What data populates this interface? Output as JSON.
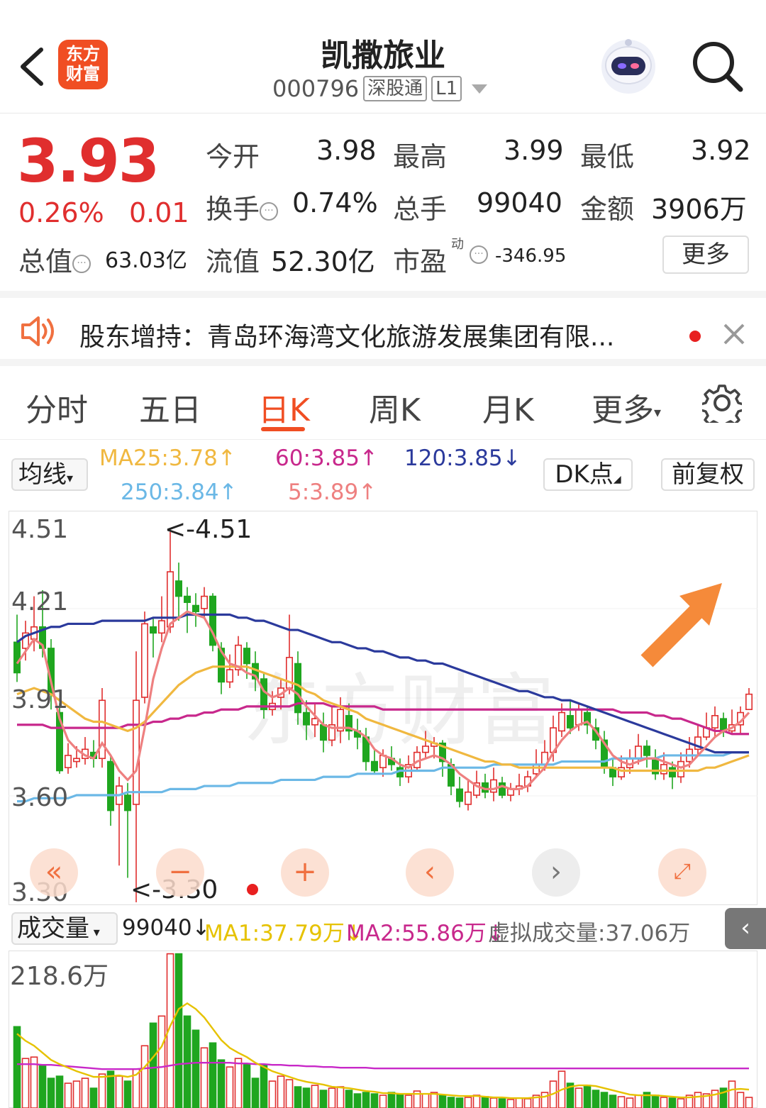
{
  "header": {
    "app_logo_text": "东方财富",
    "stock_name": "凯撒旅业",
    "stock_code": "000796",
    "tag_connect": "深股通",
    "tag_level": "L1"
  },
  "quote": {
    "price": "3.93",
    "change_pct": "0.26%",
    "change_amt": "0.01",
    "open_label": "今开",
    "open": "3.98",
    "high_label": "最高",
    "high": "3.99",
    "low_label": "最低",
    "low": "3.92",
    "turnover_label": "换手",
    "turnover": "0.74%",
    "volume_label": "总手",
    "volume": "99040",
    "amount_label": "金额",
    "amount": "3906万",
    "mktcap_label": "总值",
    "mktcap": "63.03亿",
    "float_label": "流值",
    "float": "52.30亿",
    "pe_label": "市盈",
    "pe_sup": "动",
    "pe": "-346.95",
    "more_label": "更多"
  },
  "notice": {
    "text": "股东增持：青岛环海湾文化旅游发展集团有限..."
  },
  "tabs": [
    "分时",
    "五日",
    "日K",
    "周K",
    "月K",
    "更多"
  ],
  "ma_bar": {
    "selector": "均线",
    "ma25": "MA25:3.78↑",
    "ma60": "60:3.85↑",
    "ma120": "120:3.85↓",
    "ma250": "250:3.84↑",
    "ma5": "5:3.89↑",
    "dk": "DK点",
    "adjust": "前复权"
  },
  "colors": {
    "up": "#e02e2e",
    "down": "#1fa61f",
    "ma5": "#ee8080",
    "ma25": "#f0b840",
    "ma60": "#c8288c",
    "ma120": "#2b3a9c",
    "ma250": "#6bb8e6",
    "accent": "#f04e23"
  },
  "kchart_labels": {
    "y_ticks": [
      "4.51",
      "4.21",
      "3.91",
      "3.60",
      "3.30"
    ],
    "max_note": "<-4.51",
    "min_note": "<-3.30"
  },
  "volume_bar": {
    "selector": "成交量",
    "vol": "99040↓",
    "ma1": "MA1:37.79万↓",
    "ma2": "MA2:55.86万↓",
    "virtual": "虚拟成交量:37.06万",
    "max_label": "218.6万"
  },
  "chart_data": {
    "type": "candlestick",
    "ylim": [
      3.3,
      4.51
    ],
    "candles": [
      [
        4.15,
        4.05,
        4.24,
        4.02
      ],
      [
        4.13,
        4.18,
        4.22,
        4.09
      ],
      [
        4.16,
        4.2,
        4.3,
        4.12
      ],
      [
        4.2,
        4.13,
        4.32,
        4.1
      ],
      [
        4.13,
        3.98,
        4.16,
        3.93
      ],
      [
        3.92,
        3.73,
        3.95,
        3.72
      ],
      [
        3.74,
        3.78,
        3.82,
        3.72
      ],
      [
        3.76,
        3.77,
        3.81,
        3.74
      ],
      [
        3.77,
        3.8,
        3.84,
        3.75
      ],
      [
        3.79,
        3.77,
        3.83,
        3.74
      ],
      [
        3.77,
        3.96,
        4.0,
        3.74
      ],
      [
        3.76,
        3.6,
        3.78,
        3.55
      ],
      [
        3.62,
        3.68,
        3.71,
        3.42
      ],
      [
        3.65,
        3.6,
        3.69,
        3.38
      ],
      [
        3.62,
        3.96,
        4.12,
        3.3
      ],
      [
        3.97,
        4.21,
        4.25,
        3.95
      ],
      [
        4.2,
        4.18,
        4.23,
        4.1
      ],
      [
        4.18,
        4.22,
        4.3,
        4.15
      ],
      [
        4.2,
        4.38,
        4.51,
        4.18
      ],
      [
        4.35,
        4.3,
        4.41,
        4.22
      ],
      [
        4.3,
        4.28,
        4.33,
        4.18
      ],
      [
        4.27,
        4.25,
        4.31,
        4.2
      ],
      [
        4.26,
        4.3,
        4.33,
        4.23
      ],
      [
        4.3,
        4.14,
        4.31,
        4.12
      ],
      [
        4.13,
        4.02,
        4.15,
        3.98
      ],
      [
        4.02,
        4.06,
        4.11,
        4.0
      ],
      [
        4.06,
        4.14,
        4.17,
        4.04
      ],
      [
        4.13,
        4.08,
        4.15,
        4.03
      ],
      [
        4.08,
        4.03,
        4.12,
        3.99
      ],
      [
        4.03,
        3.93,
        4.05,
        3.9
      ],
      [
        3.93,
        3.95,
        3.99,
        3.91
      ],
      [
        3.97,
        4.0,
        4.03,
        3.93
      ],
      [
        4.0,
        4.1,
        4.24,
        3.98
      ],
      [
        4.08,
        3.92,
        4.12,
        3.88
      ],
      [
        3.92,
        3.88,
        3.96,
        3.83
      ],
      [
        3.88,
        3.9,
        3.95,
        3.84
      ],
      [
        3.88,
        3.83,
        3.92,
        3.79
      ],
      [
        3.83,
        3.88,
        3.94,
        3.81
      ],
      [
        3.86,
        3.93,
        3.97,
        3.82
      ],
      [
        3.91,
        3.86,
        3.95,
        3.83
      ],
      [
        3.86,
        3.84,
        3.9,
        3.8
      ],
      [
        3.84,
        3.76,
        3.87,
        3.73
      ],
      [
        3.76,
        3.73,
        3.8,
        3.72
      ],
      [
        3.74,
        3.78,
        3.8,
        3.71
      ],
      [
        3.77,
        3.75,
        3.81,
        3.73
      ],
      [
        3.74,
        3.71,
        3.77,
        3.68
      ],
      [
        3.71,
        3.75,
        3.78,
        3.69
      ],
      [
        3.74,
        3.79,
        3.81,
        3.73
      ],
      [
        3.79,
        3.81,
        3.86,
        3.77
      ],
      [
        3.81,
        3.82,
        3.84,
        3.77
      ],
      [
        3.82,
        3.76,
        3.83,
        3.71
      ],
      [
        3.75,
        3.68,
        3.77,
        3.65
      ],
      [
        3.67,
        3.63,
        3.71,
        3.61
      ],
      [
        3.62,
        3.66,
        3.7,
        3.6
      ],
      [
        3.65,
        3.69,
        3.73,
        3.64
      ],
      [
        3.69,
        3.66,
        3.72,
        3.64
      ],
      [
        3.66,
        3.7,
        3.74,
        3.63
      ],
      [
        3.69,
        3.65,
        3.71,
        3.64
      ],
      [
        3.65,
        3.67,
        3.69,
        3.63
      ],
      [
        3.67,
        3.68,
        3.72,
        3.65
      ],
      [
        3.68,
        3.71,
        3.73,
        3.66
      ],
      [
        3.72,
        3.75,
        3.8,
        3.71
      ],
      [
        3.75,
        3.79,
        3.83,
        3.73
      ],
      [
        3.79,
        3.87,
        3.91,
        3.76
      ],
      [
        3.86,
        3.92,
        3.95,
        3.84
      ],
      [
        3.91,
        3.87,
        3.96,
        3.85
      ],
      [
        3.88,
        3.93,
        3.95,
        3.86
      ],
      [
        3.92,
        3.88,
        3.94,
        3.85
      ],
      [
        3.87,
        3.83,
        3.9,
        3.8
      ],
      [
        3.83,
        3.74,
        3.86,
        3.72
      ],
      [
        3.74,
        3.71,
        3.77,
        3.68
      ],
      [
        3.71,
        3.74,
        3.78,
        3.7
      ],
      [
        3.74,
        3.77,
        3.8,
        3.72
      ],
      [
        3.77,
        3.81,
        3.85,
        3.75
      ],
      [
        3.81,
        3.78,
        3.83,
        3.74
      ],
      [
        3.77,
        3.72,
        3.8,
        3.7
      ],
      [
        3.72,
        3.75,
        3.79,
        3.7
      ],
      [
        3.74,
        3.71,
        3.76,
        3.67
      ],
      [
        3.71,
        3.76,
        3.79,
        3.69
      ],
      [
        3.76,
        3.8,
        3.84,
        3.74
      ],
      [
        3.8,
        3.84,
        3.88,
        3.78
      ],
      [
        3.84,
        3.87,
        3.92,
        3.83
      ],
      [
        3.87,
        3.91,
        3.94,
        3.84
      ],
      [
        3.9,
        3.86,
        3.92,
        3.84
      ],
      [
        3.86,
        3.88,
        3.93,
        3.85
      ],
      [
        3.88,
        3.92,
        3.94,
        3.85
      ],
      [
        3.93,
        3.98,
        4.0,
        3.93
      ]
    ],
    "ma5": [
      4.08,
      4.12,
      4.16,
      4.14,
      4.02,
      3.9,
      3.83,
      3.8,
      3.78,
      3.77,
      3.82,
      3.78,
      3.73,
      3.7,
      3.73,
      3.87,
      4.03,
      4.13,
      4.21,
      4.23,
      4.25,
      4.24,
      4.23,
      4.18,
      4.12,
      4.08,
      4.07,
      4.05,
      4.04,
      3.99,
      3.97,
      3.98,
      4.0,
      3.98,
      3.94,
      3.91,
      3.88,
      3.87,
      3.87,
      3.87,
      3.86,
      3.84,
      3.8,
      3.78,
      3.77,
      3.75,
      3.74,
      3.76,
      3.77,
      3.78,
      3.77,
      3.75,
      3.72,
      3.7,
      3.68,
      3.67,
      3.67,
      3.68,
      3.67,
      3.67,
      3.68,
      3.71,
      3.74,
      3.79,
      3.83,
      3.86,
      3.88,
      3.89,
      3.86,
      3.82,
      3.78,
      3.76,
      3.75,
      3.76,
      3.77,
      3.77,
      3.76,
      3.75,
      3.74,
      3.75,
      3.78,
      3.81,
      3.84,
      3.86,
      3.87,
      3.89,
      3.92
    ],
    "ma25": [
      3.98,
      3.99,
      4.0,
      3.99,
      3.98,
      3.96,
      3.94,
      3.92,
      3.9,
      3.89,
      3.89,
      3.88,
      3.87,
      3.86,
      3.87,
      3.89,
      3.92,
      3.95,
      3.98,
      4.01,
      4.03,
      4.05,
      4.06,
      4.07,
      4.07,
      4.07,
      4.07,
      4.07,
      4.06,
      4.05,
      4.04,
      4.03,
      4.02,
      4.01,
      3.99,
      3.98,
      3.96,
      3.95,
      3.94,
      3.93,
      3.92,
      3.9,
      3.89,
      3.88,
      3.87,
      3.86,
      3.85,
      3.84,
      3.83,
      3.82,
      3.81,
      3.8,
      3.79,
      3.78,
      3.77,
      3.76,
      3.76,
      3.75,
      3.75,
      3.74,
      3.74,
      3.74,
      3.74,
      3.74,
      3.74,
      3.74,
      3.74,
      3.74,
      3.74,
      3.74,
      3.74,
      3.73,
      3.73,
      3.73,
      3.73,
      3.73,
      3.73,
      3.73,
      3.73,
      3.73,
      3.73,
      3.74,
      3.74,
      3.75,
      3.76,
      3.77,
      3.78
    ],
    "ma60": [
      3.88,
      3.88,
      3.88,
      3.88,
      3.87,
      3.87,
      3.87,
      3.87,
      3.87,
      3.87,
      3.87,
      3.87,
      3.87,
      3.88,
      3.88,
      3.88,
      3.89,
      3.89,
      3.9,
      3.9,
      3.91,
      3.91,
      3.92,
      3.92,
      3.93,
      3.93,
      3.93,
      3.94,
      3.94,
      3.94,
      3.94,
      3.94,
      3.94,
      3.95,
      3.95,
      3.95,
      3.95,
      3.94,
      3.94,
      3.94,
      3.94,
      3.94,
      3.94,
      3.93,
      3.93,
      3.93,
      3.93,
      3.93,
      3.93,
      3.93,
      3.93,
      3.93,
      3.93,
      3.93,
      3.93,
      3.93,
      3.93,
      3.93,
      3.93,
      3.93,
      3.93,
      3.93,
      3.93,
      3.93,
      3.93,
      3.93,
      3.93,
      3.93,
      3.93,
      3.93,
      3.93,
      3.92,
      3.92,
      3.92,
      3.92,
      3.91,
      3.91,
      3.9,
      3.9,
      3.89,
      3.88,
      3.87,
      3.86,
      3.86,
      3.85,
      3.85,
      3.85
    ],
    "ma120": [
      4.15,
      4.17,
      4.18,
      4.19,
      4.2,
      4.2,
      4.21,
      4.21,
      4.21,
      4.21,
      4.22,
      4.22,
      4.22,
      4.22,
      4.22,
      4.22,
      4.23,
      4.23,
      4.23,
      4.23,
      4.24,
      4.24,
      4.24,
      4.24,
      4.24,
      4.24,
      4.23,
      4.23,
      4.22,
      4.22,
      4.21,
      4.2,
      4.19,
      4.19,
      4.18,
      4.17,
      4.16,
      4.15,
      4.15,
      4.14,
      4.13,
      4.13,
      4.12,
      4.12,
      4.11,
      4.1,
      4.1,
      4.09,
      4.09,
      4.08,
      4.08,
      4.07,
      4.06,
      4.05,
      4.04,
      4.03,
      4.02,
      4.01,
      4.0,
      3.99,
      3.99,
      3.98,
      3.97,
      3.97,
      3.96,
      3.96,
      3.95,
      3.94,
      3.93,
      3.92,
      3.91,
      3.9,
      3.89,
      3.88,
      3.87,
      3.86,
      3.85,
      3.84,
      3.83,
      3.82,
      3.81,
      3.8,
      3.79,
      3.79,
      3.79,
      3.79,
      3.79
    ],
    "ma250": [
      3.63,
      3.63,
      3.64,
      3.64,
      3.64,
      3.64,
      3.64,
      3.65,
      3.65,
      3.65,
      3.65,
      3.65,
      3.65,
      3.66,
      3.66,
      3.66,
      3.66,
      3.66,
      3.67,
      3.67,
      3.67,
      3.67,
      3.68,
      3.68,
      3.68,
      3.68,
      3.69,
      3.69,
      3.69,
      3.69,
      3.69,
      3.7,
      3.7,
      3.7,
      3.7,
      3.7,
      3.71,
      3.71,
      3.71,
      3.71,
      3.72,
      3.72,
      3.72,
      3.72,
      3.72,
      3.73,
      3.73,
      3.73,
      3.73,
      3.73,
      3.74,
      3.74,
      3.74,
      3.74,
      3.74,
      3.74,
      3.75,
      3.75,
      3.75,
      3.75,
      3.75,
      3.75,
      3.75,
      3.75,
      3.76,
      3.76,
      3.76,
      3.76,
      3.76,
      3.76,
      3.77,
      3.77,
      3.77,
      3.77,
      3.77,
      3.77,
      3.78,
      3.78,
      3.78,
      3.78,
      3.78,
      3.78,
      3.78,
      3.78,
      3.79,
      3.79,
      3.79
    ],
    "volume_ylim": [
      0,
      218.6
    ],
    "volumes": [
      115,
      70,
      72,
      60,
      42,
      45,
      35,
      38,
      42,
      28,
      48,
      52,
      45,
      38,
      55,
      88,
      120,
      130,
      218,
      218,
      130,
      110,
      85,
      92,
      68,
      58,
      70,
      62,
      42,
      60,
      38,
      45,
      40,
      30,
      28,
      32,
      25,
      28,
      30,
      25,
      20,
      22,
      20,
      18,
      22,
      20,
      18,
      24,
      20,
      22,
      18,
      15,
      14,
      15,
      18,
      16,
      14,
      13,
      12,
      14,
      13,
      18,
      22,
      38,
      52,
      35,
      28,
      32,
      25,
      22,
      18,
      16,
      14,
      18,
      22,
      18,
      15,
      14,
      13,
      18,
      22,
      20,
      25,
      28,
      38,
      22,
      15
    ],
    "vol_ma1": [
      105,
      95,
      88,
      78,
      68,
      62,
      57,
      52,
      48,
      44,
      44,
      45,
      46,
      44,
      47,
      58,
      72,
      87,
      116,
      140,
      148,
      140,
      128,
      112,
      96,
      85,
      78,
      72,
      64,
      58,
      52,
      48,
      44,
      40,
      37,
      35,
      33,
      30,
      29,
      28,
      26,
      24,
      23,
      21,
      21,
      20,
      20,
      20,
      20,
      20,
      19,
      18,
      17,
      17,
      17,
      16,
      15,
      15,
      14,
      14,
      14,
      15,
      16,
      20,
      26,
      30,
      32,
      32,
      31,
      28,
      25,
      22,
      19,
      18,
      18,
      18,
      17,
      16,
      15,
      15,
      16,
      17,
      19,
      22,
      26,
      27,
      26
    ],
    "vol_ma2": [
      62,
      62,
      62,
      61,
      61,
      60,
      59,
      58,
      57,
      56,
      55,
      55,
      55,
      55,
      55,
      56,
      57,
      58,
      60,
      62,
      63,
      64,
      64,
      64,
      64,
      64,
      63,
      63,
      62,
      62,
      61,
      61,
      60,
      60,
      59,
      59,
      58,
      58,
      57,
      57,
      57,
      57,
      56,
      56,
      56,
      56,
      56,
      56,
      56,
      56,
      56,
      56,
      56,
      56,
      56,
      56,
      56,
      56,
      56,
      56,
      56,
      56,
      56,
      56,
      56,
      56,
      56,
      56,
      56,
      56,
      56,
      56,
      56,
      56,
      56,
      56,
      56,
      56,
      56,
      56,
      56,
      56,
      56,
      56,
      56,
      56,
      56
    ]
  }
}
